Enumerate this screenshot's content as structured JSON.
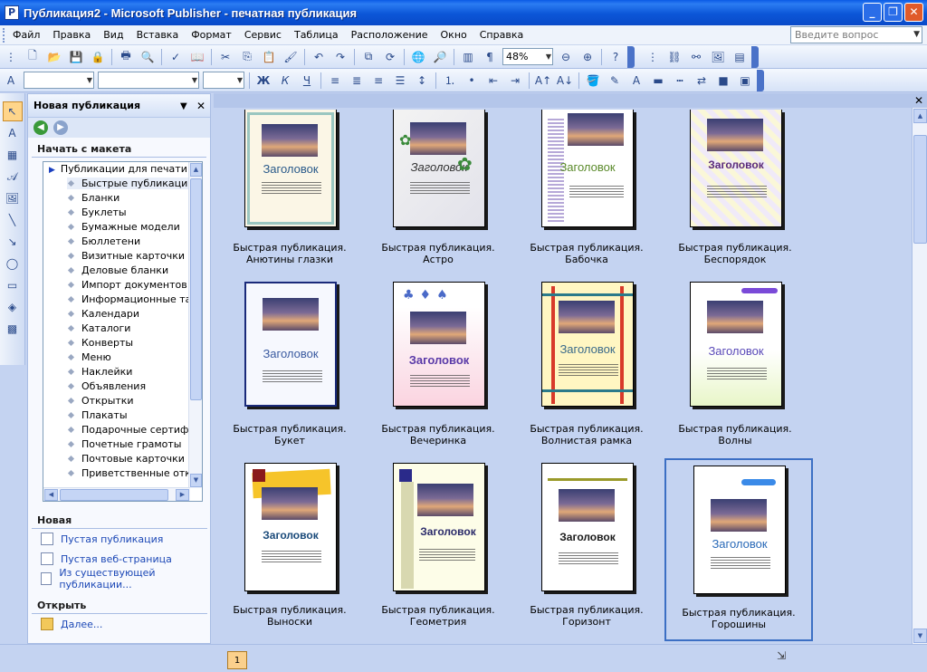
{
  "window": {
    "title": "Публикация2 - Microsoft Publisher - печатная публикация",
    "app_icon": "P"
  },
  "menu": [
    "Файл",
    "Правка",
    "Вид",
    "Вставка",
    "Формат",
    "Сервис",
    "Таблица",
    "Расположение",
    "Окно",
    "Справка"
  ],
  "help_placeholder": "Введите вопрос",
  "toolbar": {
    "zoom": "48%"
  },
  "taskpane": {
    "title": "Новая публикация",
    "section_start": "Начать с макета",
    "tree_root": "Публикации для печати",
    "tree_items": [
      "Быстрые публикации",
      "Бланки",
      "Буклеты",
      "Бумажные модели",
      "Бюллетени",
      "Визитные карточки",
      "Деловые бланки",
      "Импорт документов Word",
      "Информационные таблички",
      "Календари",
      "Каталоги",
      "Конверты",
      "Меню",
      "Наклейки",
      "Объявления",
      "Открытки",
      "Плакаты",
      "Подарочные сертификаты",
      "Почетные грамоты",
      "Почтовые карточки",
      "Приветственные открытки"
    ],
    "section_new": "Новая",
    "new_links": [
      "Пустая публикация",
      "Пустая веб-страница",
      "Из существующей публикации..."
    ],
    "section_open": "Открыть",
    "open_link": "Далее..."
  },
  "catalog": {
    "heading": "Заголовок",
    "tiles": [
      "Быстрая публикация. Анютины глазки",
      "Быстрая публикация. Астро",
      "Быстрая публикация. Бабочка",
      "Быстрая публикация. Беспорядок",
      "Быстрая публикация. Букет",
      "Быстрая публикация. Вечеринка",
      "Быстрая публикация. Волнистая рамка",
      "Быстрая публикация. Волны",
      "Быстрая публикация. Выноски",
      "Быстрая публикация. Геометрия",
      "Быстрая публикация. Горизонт",
      "Быстрая публикация. Горошины"
    ]
  },
  "status": {
    "page_number": "1"
  }
}
